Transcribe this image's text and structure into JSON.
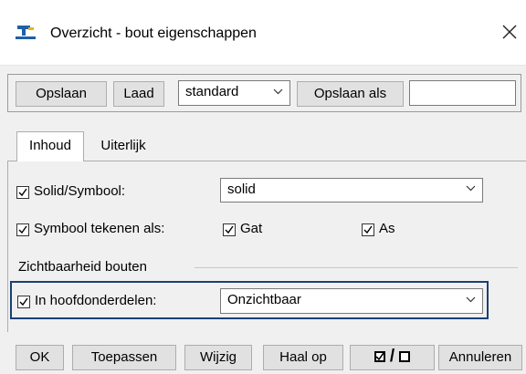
{
  "window": {
    "title": "Overzicht - bout eigenschappen"
  },
  "toolbar": {
    "save_label": "Opslaan",
    "load_label": "Laad",
    "preset_value": "standard",
    "save_as_label": "Opslaan als",
    "save_as_input_value": ""
  },
  "tabs": [
    {
      "label": "Inhoud",
      "active": true
    },
    {
      "label": "Uiterlijk",
      "active": false
    }
  ],
  "content": {
    "solid_symbool": {
      "label": "Solid/Symbool:",
      "checked": true,
      "value": "solid"
    },
    "symbool_tekenen": {
      "label": "Symbool tekenen als:",
      "checked": true,
      "gat_label": "Gat",
      "gat_checked": true,
      "as_label": "As",
      "as_checked": true
    },
    "group_title": "Zichtbaarheid bouten",
    "hoofdonderdelen": {
      "label": "In hoofdonderdelen:",
      "checked": true,
      "value": "Onzichtbaar"
    }
  },
  "bottom": {
    "ok_label": "OK",
    "apply_label": "Toepassen",
    "modify_label": "Wijzig",
    "get_label": "Haal op",
    "toggle_separator": "/",
    "cancel_label": "Annuleren"
  },
  "colors": {
    "highlight_border": "#1b3f73",
    "app_icon_blue": "#1f5fa8",
    "app_icon_yellow": "#e7b514"
  }
}
